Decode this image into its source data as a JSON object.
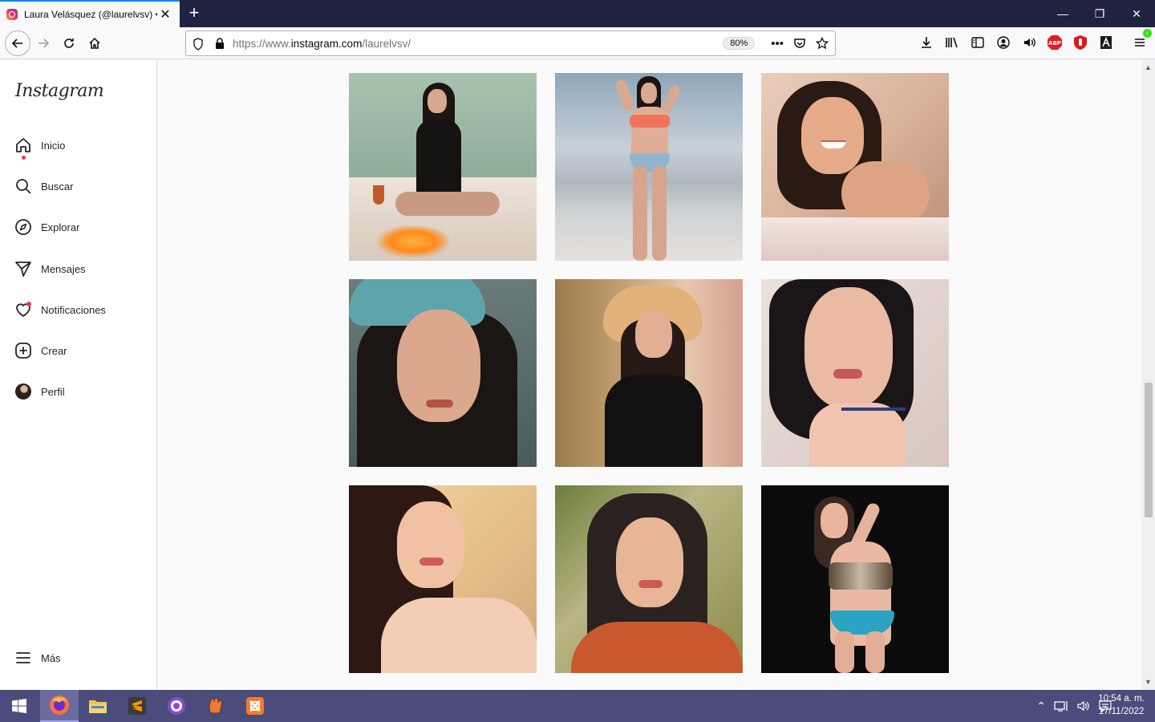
{
  "browser": {
    "tab_title": "Laura Velásquez (@laurelvsv) •",
    "url_prefix": "https://www.",
    "url_domain": "instagram.com",
    "url_path": "/laurelvsv/",
    "zoom": "80%"
  },
  "instagram": {
    "logo": "Instagram",
    "nav": [
      {
        "label": "Inicio",
        "icon": "home-icon"
      },
      {
        "label": "Buscar",
        "icon": "search-icon"
      },
      {
        "label": "Explorar",
        "icon": "compass-icon"
      },
      {
        "label": "Mensajes",
        "icon": "send-icon"
      },
      {
        "label": "Notificaciones",
        "icon": "heart-icon"
      },
      {
        "label": "Crear",
        "icon": "plus-square-icon"
      },
      {
        "label": "Perfil",
        "icon": "avatar"
      }
    ],
    "more": "Más",
    "posts": [
      {
        "subject": "woman in black swimsuit with wine glass on boat",
        "bg": "#9fb8a6"
      },
      {
        "subject": "woman in bikini at beach",
        "bg": "#b4bdc6"
      },
      {
        "subject": "smiling woman selfie",
        "bg": "#e2c5b2"
      },
      {
        "subject": "woman in teal beanie",
        "bg": "#3a4a4c"
      },
      {
        "subject": "woman in straw hat",
        "bg": "#c79a6c"
      },
      {
        "subject": "close-up selfie with choker",
        "bg": "#d7c6bd"
      },
      {
        "subject": "selfie long dark hair",
        "bg": "#e2c391"
      },
      {
        "subject": "selfie in garden",
        "bg": "#8c8a4a"
      },
      {
        "subject": "woman in bikini dark background",
        "bg": "#0c0c0c"
      }
    ]
  },
  "taskbar": {
    "time": "10:54 a. m.",
    "date": "17/11/2022"
  }
}
